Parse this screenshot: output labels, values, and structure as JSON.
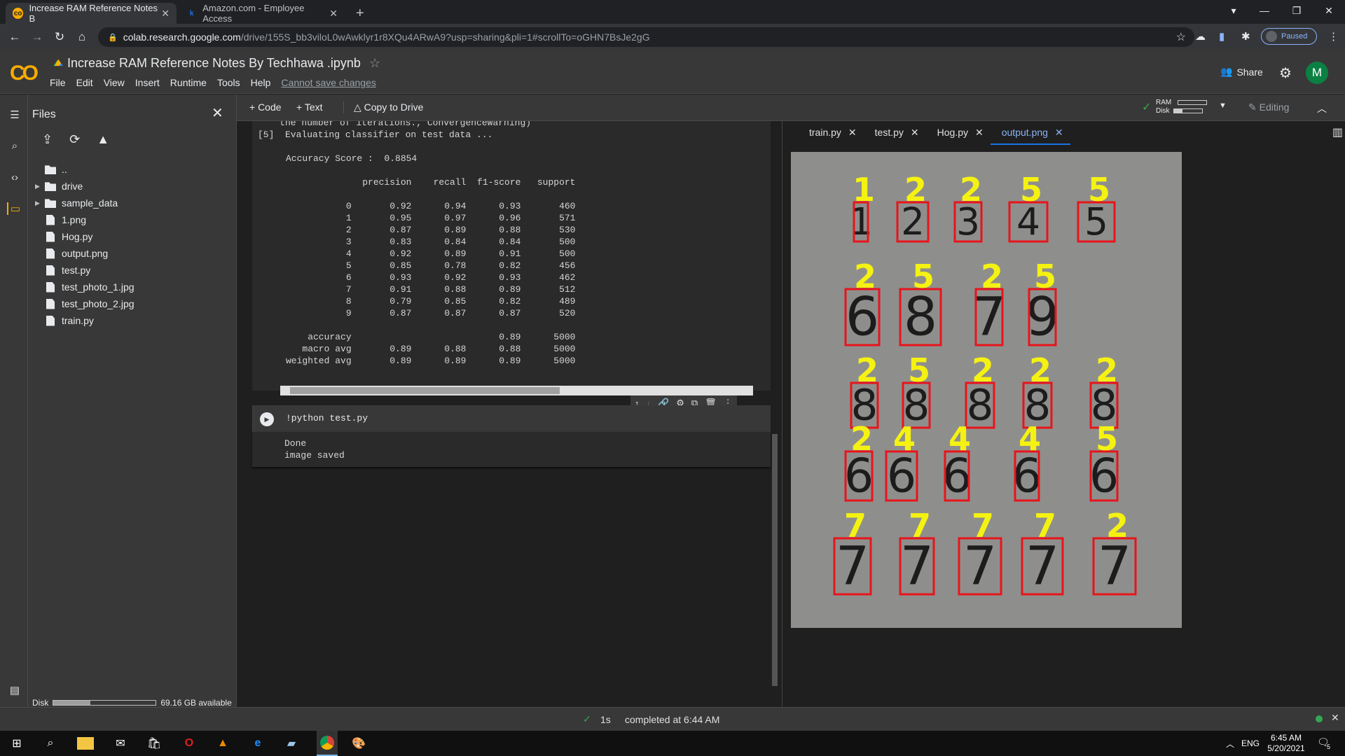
{
  "browser": {
    "tabs": [
      {
        "title": "Increase RAM Reference Notes B",
        "active": true
      },
      {
        "title": "Amazon.com - Employee Access",
        "active": false
      }
    ],
    "new_tab": "+",
    "url_host": "colab.research.google.com",
    "url_path": "/drive/155S_bb3viloL0wAwklyr1r8XQu4ARwA9?usp=sharing&pli=1#scrollTo=oGHN7BsJe2gG",
    "profile_status": "Paused"
  },
  "colab": {
    "logo": "CO",
    "notebook_title": "Increase RAM Reference Notes By Techhawa .ipynb",
    "menu": [
      "File",
      "Edit",
      "View",
      "Insert",
      "Runtime",
      "Tools",
      "Help"
    ],
    "cannot_save": "Cannot save changes",
    "share": "Share",
    "avatar_letter": "M",
    "toolbar": {
      "code": "+ Code",
      "text": "+ Text",
      "copy_to_drive": "Copy to Drive",
      "ram": "RAM",
      "disk": "Disk",
      "editing": "Editing"
    }
  },
  "files_panel": {
    "title": "Files",
    "items": [
      {
        "name": "..",
        "type": "up"
      },
      {
        "name": "drive",
        "type": "folder"
      },
      {
        "name": "sample_data",
        "type": "folder"
      },
      {
        "name": "1.png",
        "type": "file"
      },
      {
        "name": "Hog.py",
        "type": "file"
      },
      {
        "name": "output.png",
        "type": "file"
      },
      {
        "name": "test.py",
        "type": "file"
      },
      {
        "name": "test_photo_1.jpg",
        "type": "file"
      },
      {
        "name": "test_photo_2.jpg",
        "type": "file"
      },
      {
        "name": "train.py",
        "type": "file"
      }
    ],
    "disk_label": "Disk",
    "disk_available": "69.16 GB available",
    "disk_used_fraction": 0.36
  },
  "output_cell": {
    "lines": [
      "    the number of iterations., ConvergenceWarning)",
      "[5]  Evaluating classifier on test data ...",
      "",
      "Accuracy Score :  0.8854",
      "",
      "              precision    recall  f1-score   support",
      "",
      "           0       0.92      0.94      0.93       460",
      "           1       0.95      0.97      0.96       571",
      "           2       0.87      0.89      0.88       530",
      "           3       0.83      0.84      0.84       500",
      "           4       0.92      0.89      0.91       500",
      "           5       0.85      0.78      0.82       456",
      "           6       0.93      0.92      0.93       462",
      "           7       0.91      0.88      0.89       512",
      "           8       0.79      0.85      0.82       489",
      "           9       0.87      0.87      0.87       520",
      "",
      "    accuracy                           0.89      5000",
      "   macro avg       0.89      0.88      0.88      5000",
      "weighted avg       0.89      0.89      0.89      5000"
    ]
  },
  "code_cell": {
    "source": "!python test.py",
    "output": [
      "Done",
      "image saved"
    ]
  },
  "editor": {
    "tabs": [
      {
        "name": "train.py",
        "active": false
      },
      {
        "name": "test.py",
        "active": false
      },
      {
        "name": "Hog.py",
        "active": false
      },
      {
        "name": "output.png",
        "active": true
      }
    ]
  },
  "output_image": {
    "box_color": "#e8141c",
    "label_color": "#f5f212",
    "rows": [
      [
        {
          "digit": "1",
          "label": "1"
        },
        {
          "digit": "2",
          "label": "2"
        },
        {
          "digit": "3",
          "label": "2"
        },
        {
          "digit": "4",
          "label": "5"
        },
        {
          "digit": "5",
          "label": "5"
        }
      ],
      [
        {
          "digit": "6",
          "label": "2"
        },
        {
          "digit": "8",
          "label": "5"
        },
        {
          "digit": "7",
          "label": "2"
        },
        {
          "digit": "9",
          "label": "5"
        }
      ],
      [
        {
          "digit": "8",
          "label": "2"
        },
        {
          "digit": "8",
          "label": "5"
        },
        {
          "digit": "8",
          "label": "2"
        },
        {
          "digit": "8",
          "label": "2"
        },
        {
          "digit": "8",
          "label": "2"
        }
      ],
      [
        {
          "digit": "6",
          "label": "2"
        },
        {
          "digit": "6",
          "label": "4"
        },
        {
          "digit": "6",
          "label": "4"
        },
        {
          "digit": "6",
          "label": "4"
        },
        {
          "digit": "6",
          "label": "5"
        }
      ],
      [
        {
          "digit": "7",
          "label": "7"
        },
        {
          "digit": "7",
          "label": "7"
        },
        {
          "digit": "7",
          "label": "7"
        },
        {
          "digit": "7",
          "label": "7"
        },
        {
          "digit": "7",
          "label": "2"
        }
      ]
    ]
  },
  "status_bar": {
    "duration": "1s",
    "completed": "completed at 6:44 AM"
  },
  "taskbar": {
    "language": "ENG",
    "time": "6:45 AM",
    "date": "5/20/2021",
    "notifications": "5"
  }
}
